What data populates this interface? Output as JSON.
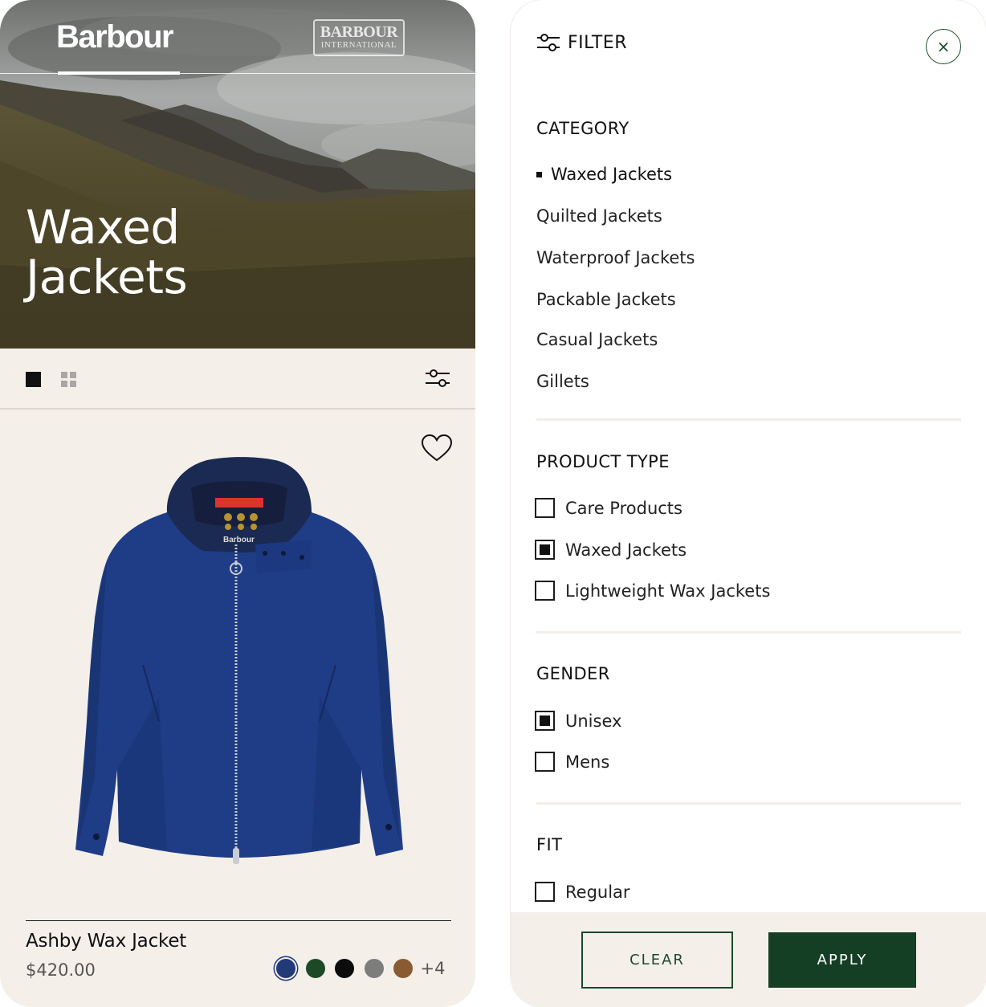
{
  "product_list": {
    "brand": "Barbour",
    "sub_brand_line1": "BARBOUR",
    "sub_brand_line2": "INTERNATIONAL",
    "hero_title_line1": "Waxed",
    "hero_title_line2": "Jackets",
    "product": {
      "name": "Ashby Wax Jacket",
      "price": "$420.00",
      "swatch_colors": [
        "#233a78",
        "#1d4a26",
        "#0c0c0c",
        "#7d7d7b",
        "#8a5a32"
      ],
      "selected_swatch": 0,
      "more_colors": "+4"
    },
    "colors": {
      "background": "#f5efea",
      "jacket": "#1f3c86"
    }
  },
  "filter": {
    "title": "FILTER",
    "close_glyph": "×",
    "category": {
      "title": "CATEGORY",
      "items": [
        "Waxed Jackets",
        "Quilted Jackets",
        "Waterproof Jackets",
        "Packable Jackets",
        "Casual Jackets",
        "Gillets"
      ],
      "active_index": 0
    },
    "product_type": {
      "title": "PRODUCT TYPE",
      "options": [
        {
          "label": "Care Products",
          "checked": false
        },
        {
          "label": "Waxed Jackets",
          "checked": true
        },
        {
          "label": "Lightweight Wax Jackets",
          "checked": false
        }
      ]
    },
    "gender": {
      "title": "GENDER",
      "options": [
        {
          "label": "Unisex",
          "checked": true
        },
        {
          "label": "Mens",
          "checked": false
        }
      ]
    },
    "fit": {
      "title": "FIT",
      "options": [
        {
          "label": "Regular",
          "checked": false
        }
      ]
    },
    "actions": {
      "clear": "CLEAR",
      "apply": "APPLY"
    },
    "colors": {
      "accent": "#143f24",
      "divider": "#f4ede8"
    }
  }
}
